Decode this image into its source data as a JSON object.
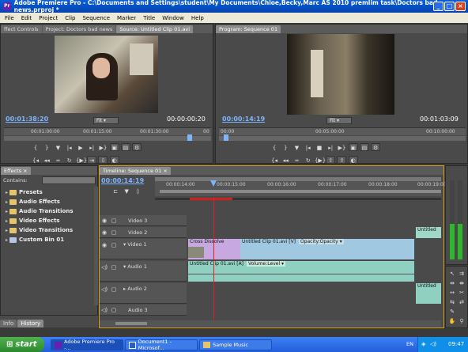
{
  "window": {
    "title": "Adobe Premiere Pro - C:\\Documents and Settings\\student\\My Documents\\Chloe,Becky,Marc AS 2010 premlim task\\Doctors bad news.prproj *"
  },
  "menu": [
    "File",
    "Edit",
    "Project",
    "Clip",
    "Sequence",
    "Marker",
    "Title",
    "Window",
    "Help"
  ],
  "source_panel": {
    "tabs": [
      "ffect Controls",
      "Project: Doctors bad news",
      "Source: Untitled Clip 01.avi"
    ],
    "timecode_current": "00:01:38:20",
    "timecode_duration": "00:00:00:20",
    "zoom": "Fit",
    "ruler": [
      "00:01:00:00",
      "00:01:15:00",
      "00:01:30:00",
      "00"
    ]
  },
  "program_panel": {
    "tabs": [
      "Program: Sequence 01"
    ],
    "timecode_current": "00:00:14:19",
    "timecode_duration": "00:01:03:09",
    "zoom": "Fit",
    "ruler": [
      "00:00",
      "00:05:00:00",
      "00:10:00:00"
    ]
  },
  "effects_panel": {
    "tabs": [
      "Effects"
    ],
    "contains_label": "Contains:",
    "items": [
      {
        "label": "Presets",
        "color": "#e6c46a"
      },
      {
        "label": "Audio Effects",
        "color": "#e6c46a"
      },
      {
        "label": "Audio Transitions",
        "color": "#e6c46a"
      },
      {
        "label": "Video Effects",
        "color": "#e6c46a"
      },
      {
        "label": "Video Transitions",
        "color": "#e6c46a"
      },
      {
        "label": "Custom Bin 01",
        "color": "#b7c4e6"
      }
    ],
    "bottom_tabs": [
      "Info",
      "History"
    ]
  },
  "timeline": {
    "tab": "Timeline: Sequence 01",
    "timecode": "00:00:14:19",
    "ruler": [
      "00:00:14:00",
      "00:00:15:00",
      "00:00:16:00",
      "00:00:17:00",
      "00:00:18:00",
      "00:00:19:00",
      "00:00"
    ],
    "tracks": [
      "Video 3",
      "Video 2",
      "Video 1",
      "Audio 1",
      "Audio 2",
      "Audio 3"
    ],
    "clips": {
      "cross_dissolve": "Cross Dissolve",
      "video1_clip": "Untitled Clip 01.avi [V]",
      "video1_fx": "Opacity:Opacity",
      "video2_right": "Untitled",
      "audio1_clip": "Untitled Clip 01.avi [A]",
      "audio1_fx": "Volume:Level",
      "audio2_right": "Untitled"
    }
  },
  "taskbar": {
    "start": "start",
    "items": [
      "Adobe Premiere Pro -...",
      "Document1 - Microsof...",
      "Sample Music"
    ],
    "lang": "EN",
    "clock": "09:47"
  }
}
